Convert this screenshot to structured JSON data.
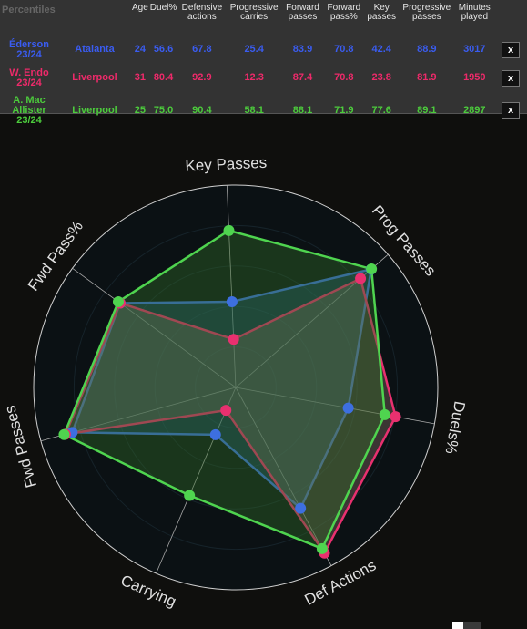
{
  "table": {
    "headers": [
      "Percentiles",
      "",
      "Age",
      "Duel%",
      "Defensive actions",
      "Progressive carries",
      "Forward passes",
      "Forward pass%",
      "Key passes",
      "Progressive passes",
      "Minutes played"
    ],
    "remove_label": "x",
    "rows": [
      {
        "player": "Éderson",
        "season": "23/24",
        "team": "Atalanta",
        "color": "#3a5cf0",
        "values": [
          "24",
          "56.6",
          "67.8",
          "25.4",
          "83.9",
          "70.8",
          "42.4",
          "88.9",
          "3017"
        ]
      },
      {
        "player": "W. Endo",
        "season": "23/24",
        "team": "Liverpool",
        "color": "#ee2a6a",
        "values": [
          "31",
          "80.4",
          "92.9",
          "12.3",
          "87.4",
          "70.8",
          "23.8",
          "81.9",
          "1950"
        ]
      },
      {
        "player": "A. Mac Allister",
        "season": "23/24",
        "team": "Liverpool",
        "color": "#4ccc3c",
        "values": [
          "25",
          "75.0",
          "90.4",
          "58.1",
          "88.1",
          "71.9",
          "77.6",
          "89.1",
          "2897"
        ]
      }
    ]
  },
  "chart_data": {
    "type": "radar",
    "axes": [
      "Key Passes",
      "Prog Passes",
      "Duels%",
      "Def Actions",
      "Carrying",
      "Fwd Passes",
      "Fwd Pass%"
    ],
    "range": [
      0,
      100
    ],
    "series": [
      {
        "name": "Éderson",
        "color": "#3d6fe0",
        "fill": "rgba(40,110,160,0.35)",
        "values": [
          42.4,
          88.9,
          56.6,
          67.8,
          25.4,
          83.9,
          70.8
        ]
      },
      {
        "name": "W. Endo",
        "color": "#e8306f",
        "fill": "rgba(150,120,110,0.35)",
        "values": [
          23.8,
          81.9,
          80.4,
          92.9,
          12.3,
          87.4,
          70.8
        ]
      },
      {
        "name": "A. Mac Allister",
        "color": "#4fd44f",
        "fill": "rgba(50,110,40,0.4)",
        "values": [
          77.6,
          89.1,
          75.0,
          90.4,
          58.1,
          88.1,
          71.9
        ]
      }
    ]
  }
}
